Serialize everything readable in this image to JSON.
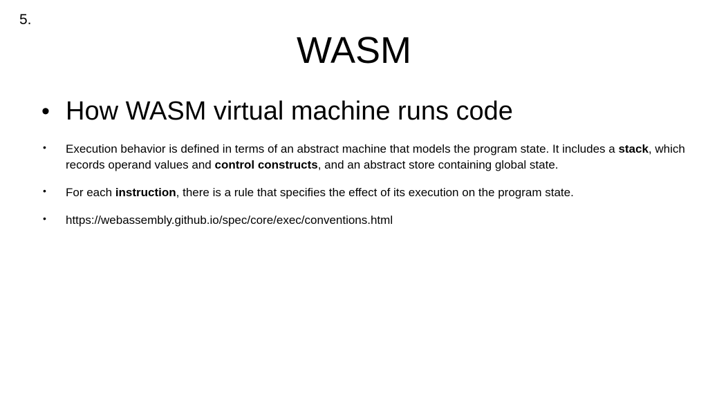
{
  "slide": {
    "number": "5.",
    "title": "WASM"
  },
  "bullets": {
    "marker": "•",
    "heading": "How WASM virtual machine runs code",
    "b1": {
      "t1": "Execution behavior is defined in terms of an abstract machine that models the program state. It includes a ",
      "bold1": "stack",
      "t2": ", which records operand values and ",
      "bold2": "control constructs",
      "t3": ", and an abstract store containing global state."
    },
    "b2": {
      "t1": "For each ",
      "bold1": "instruction",
      "t2": ", there is a rule that specifies the effect of its execution on the program state."
    },
    "b3": {
      "t1": "https://webassembly.github.io/spec/core/exec/conventions.html"
    }
  }
}
